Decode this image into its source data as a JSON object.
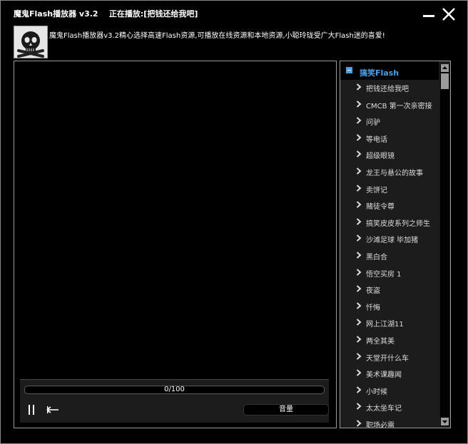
{
  "window": {
    "title": "魔鬼Flash播放器 v3.2    正在播放:[把钱还给我吧]"
  },
  "header": {
    "description": "魔鬼Flash播放器v3.2精心选择高速Flash资源,可播放在线资源和本地资源,小聪玲珑受广大Flash迷的喜爱!"
  },
  "player": {
    "progress_text": "0/100",
    "progress_fraction": 0.0,
    "volume_label": "音量"
  },
  "playlist": {
    "header_label": "搞笑Flash",
    "items": [
      "把钱还给我吧",
      "CMCB 第一次亲密接",
      "问驴",
      "等电话",
      "超级眼镜",
      "龙王与悬公的故事",
      "卖饼记",
      "赌徒令尊",
      "搞笑皮皮系列之师生",
      "沙滩足球 毕加猪",
      "黑白合",
      "悟空买房 1",
      "夜盗",
      "忏悔",
      "网上江湖11",
      "两全其美",
      "天堂开什么车",
      "美术课趣闻",
      "小时候",
      "太太坐车记",
      "职场必需"
    ]
  },
  "colors": {
    "window_bg": "#000000",
    "panel_bg": "#1c1c1c",
    "text": "#ffffff",
    "playlist_header_text": "#4aa0e6",
    "border": "#9a9a9a"
  }
}
